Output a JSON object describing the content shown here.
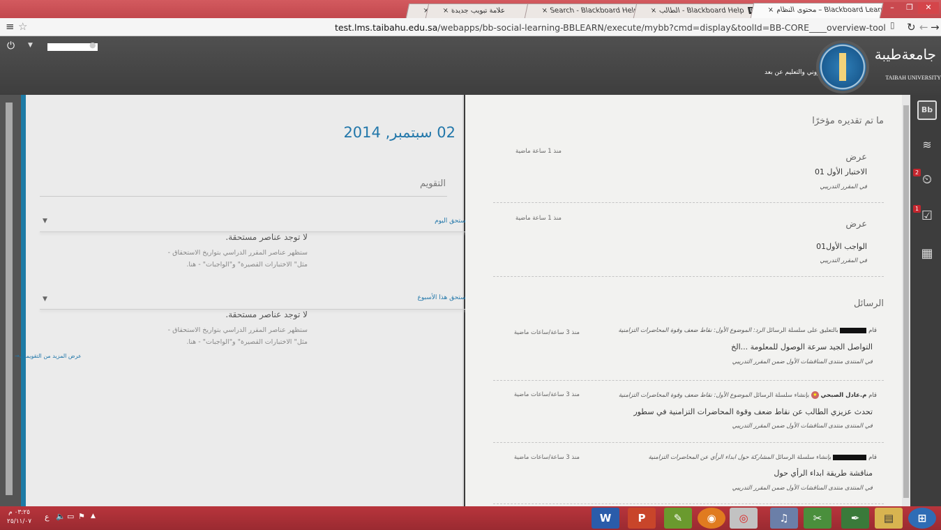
{
  "browser": {
    "tabs": [
      {
        "label": "محتوى النظام – Blackboard Learn",
        "close": "×"
      },
      {
        "label": "الطالب - Blackboard Help",
        "close": "×"
      },
      {
        "label": "Search - Blackboard Help",
        "close": "×"
      },
      {
        "label": "علامة تبويب جديدة",
        "close": "×"
      },
      {
        "label": "",
        "close": "×"
      }
    ],
    "bb_badge": "Bb",
    "url_host": "test.lms.taibahu.edu.sa",
    "url_path": "/webapps/bb-social-learning-BBLEARN/execute/mybb?cmd=display&toolId=BB-CORE____overview-tool"
  },
  "header": {
    "university_name": "جامعةطيبة",
    "university_en": "TAIBAH UNIVERSITY",
    "deanship": "عمادة التعليم الإلكتروني والتعليم عن بعد"
  },
  "calendar": {
    "date": "02 سبتمبر, 2014",
    "section_title": "التقويم",
    "today_label": "مستحق اليوم",
    "week_label": "مستحق هذا الأسبوع",
    "none_title": "لا توجد عناصر مستحقة.",
    "none_line1": "ستظهر عناصر المقرر الدراسي بتواريخ الاستحقاق -",
    "none_line2": "مثل\" الاختبارات القصيرة\" و\"الواجبات\" - هنا.",
    "more_link": "عرض المزيد من التقويمات→"
  },
  "graded": {
    "title": "ما تم تقديره مؤخرًا",
    "items": [
      {
        "action": "عرض",
        "name": "الاختبار الأول 01",
        "course": "في المقرر التدريبي",
        "time": "منذ 1 ساعة ماضية"
      },
      {
        "action": "عرض",
        "name": "الواجب الأول01",
        "course": "في المقرر التدريبي",
        "time": "منذ 1 ساعة ماضية"
      }
    ]
  },
  "messages": {
    "title": "الرسائل",
    "items": [
      {
        "meta_pre": "قام",
        "meta_post": "بالتعليق على سلسلة الرسائل",
        "meta_italic": "الرد: الموضوع الأول: نقاط ضعف وقوة المحاضرات التزامنية",
        "body": "التواصل الجيد سرعة الوصول للمعلومة ...الخ",
        "forum": "في المنتدى منتدى المناقشات الأول ضمن المقرر التدريبي",
        "time": "منذ 3 ساعة/ساعات ماضية"
      },
      {
        "meta_pre": "قام",
        "meta_name": "م.عادل الصبحي",
        "meta_post": "بإنشاء سلسلة الرسائل",
        "meta_italic": "الموضوع الأول: نقاط ضعف وقوة المحاضرات التزامنية",
        "body": "تحدث عزيزي الطالب عن نقاط ضعف وقوة المحاضرات التزامنية في سطور",
        "forum": "في المنتدى منتدى المناقشات الأول ضمن المقرر التدريبي",
        "time": "منذ 3 ساعة/ساعات ماضية"
      },
      {
        "meta_pre": "قام",
        "meta_post": "بإنشاء سلسلة الرسائل",
        "meta_italic": "المشاركة حول ابداء الرأي عن المحاضرات التزامنية",
        "body": "مناقشة طريقة ابداء الرأي حول",
        "forum": "في المنتدى منتدى المناقشات الأول ضمن المقرر التدريبي",
        "time": "منذ 3 ساعة/ساعات ماضية"
      }
    ]
  },
  "sidebar": {
    "badge_alerts": "2",
    "badge_tasks": "1"
  },
  "taskbar": {
    "time": "٠٣:٢٥ م",
    "date": "٢٥/١١/٠٧",
    "lang": "ع"
  }
}
